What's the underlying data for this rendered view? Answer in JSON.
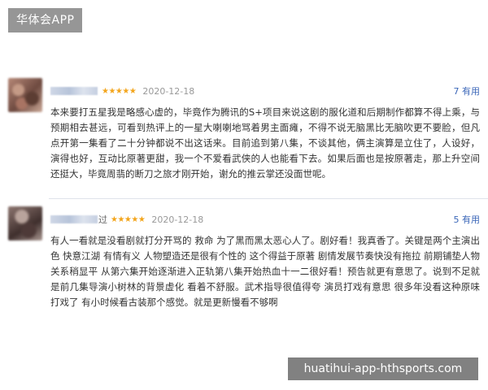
{
  "app_badge": "华体会APP",
  "watermark": "huatihui-app-hthsports.com",
  "reviews": [
    {
      "user_suffix": "",
      "stars": "★★★★★",
      "date": "2020-12-18",
      "reply_count": "7",
      "reply_unit": "有用",
      "text": "本来要打五星我是略感心虚的，毕竟作为腾讯的S+项目来说这剧的服化道和后期制作都算不得上乘，与预期相去甚远，可看到热评上的一星大喇喇地骂着男主面瘫，不得不说无脑黑比无脑吹更不要脸，但凡点开第一集看了二十分钟都说不出这话来。目前追到第八集，不谈其他，俩主演算是立住了，人设好，演得也好，互动比原著更甜，我一个不爱看武侠的人也能看下去。如果后面也是按原著走，那上升空间还挺大，毕竟周翡的断刀之旅才刚开始，谢允的推云掌还没面世呢。"
    },
    {
      "user_suffix": "过",
      "stars": "★★★★★",
      "date": "2020-12-18",
      "reply_count": "5",
      "reply_unit": "有用",
      "text": "有人一看就是没看剧就打分开骂的 救命 为了黑而黑太恶心人了。剧好看！我真香了。关键是两个主演出色 快意江湖 有情有义 人物塑造还是很有个性的 这个得益于原著 剧情发展节奏快没有拖拉 前期铺垫人物关系稍显平 从第六集开始逐渐进入正轨第八集开始热血十一二很好看！预告就更有意思了。说到不足就是前几集导演小树林的背景虚化 看着不舒服。武术指导很值得夸 演员打戏有意思 很多年没看这种原味打戏了 有小时候看古装那个感觉。就是更新慢看不够啊"
    }
  ],
  "colors": {
    "star": "#f3a51c",
    "link": "#3a66b8"
  }
}
